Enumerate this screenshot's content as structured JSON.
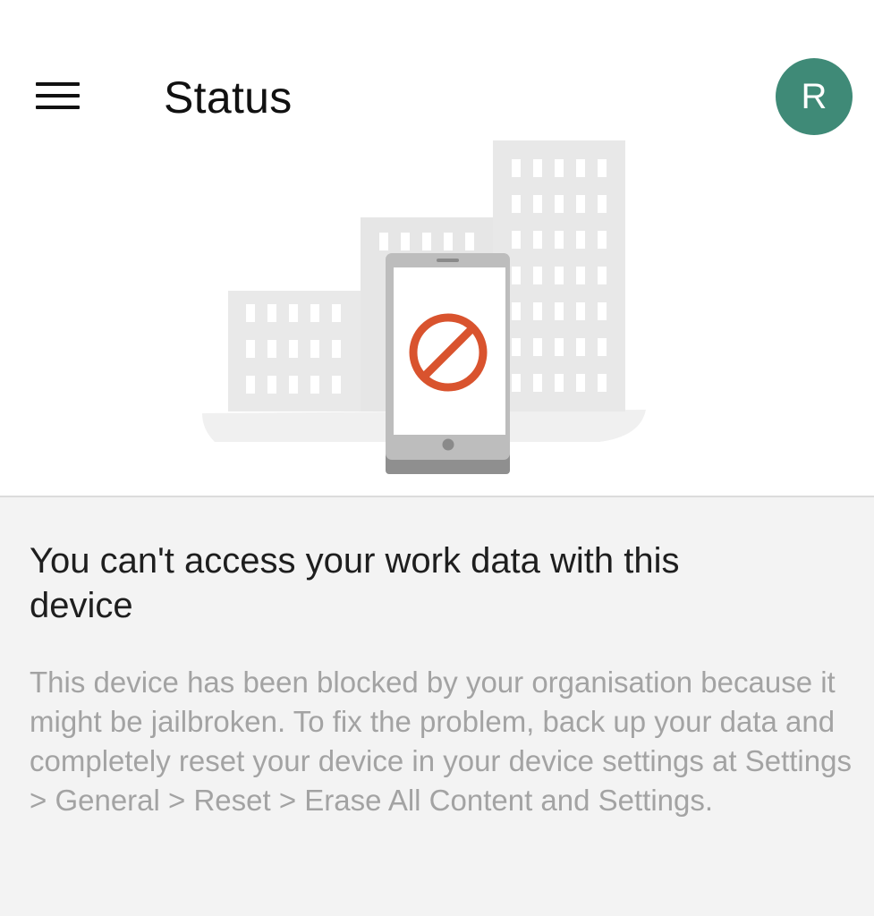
{
  "header": {
    "title": "Status",
    "avatar_initial": "R",
    "avatar_color": "#3f8a77"
  },
  "icons": {
    "menu": "hamburger-menu-icon",
    "blocked": "prohibited-icon",
    "illustration": "office-buildings-with-phone"
  },
  "colors": {
    "blocked_accent": "#d9532e",
    "content_background": "#f3f3f3"
  },
  "message": {
    "heading": "You can't access your work data with this device",
    "body": "This device has been blocked by your organisation because it might be jailbroken. To fix the problem, back up your data and completely reset your device in your device settings at Settings > General > Reset > Erase All Content and Settings."
  }
}
